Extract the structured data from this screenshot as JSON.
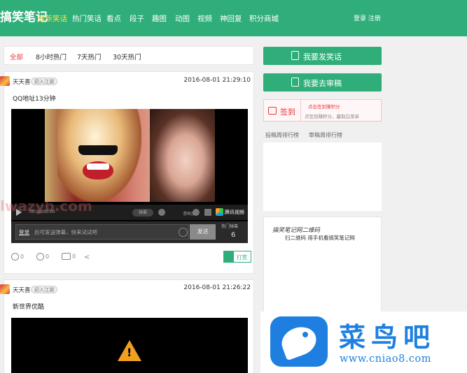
{
  "header": {
    "logo": "搞笑笔记",
    "nav": [
      "最新笑话",
      "热门笑话",
      "看点",
      "段子",
      "趣图",
      "动图",
      "视频",
      "神回复",
      "积分商城"
    ],
    "active_nav": "最新笑话",
    "login": "登录  注册"
  },
  "tabs": [
    "全部",
    "8小时热门",
    "7天热门",
    "30天热门"
  ],
  "posts": [
    {
      "author": "天天喜",
      "badge": "初入江湖",
      "time": "2016-08-01 21:29:10",
      "title": "QQ地址13分钟",
      "player": {
        "time": "00:00/00:00",
        "pill": "弹幕",
        "small": "清晰度",
        "brand": "腾讯视频"
      },
      "comment": {
        "login": "登录",
        "hint": "后可发送弹幕，快来试试吧",
        "send": "发送",
        "hot_label": "热门弹幕",
        "hot_count": "6"
      },
      "actions": {
        "like": "0",
        "dislike": "0",
        "comments": "0",
        "reward": "打赏"
      }
    },
    {
      "author": "天天喜",
      "badge": "初入江湖",
      "time": "2016-08-01 21:26:22",
      "title": "新世界优酷"
    }
  ],
  "sidebar": {
    "publish": "我要发笑话",
    "review": "我要去审稿",
    "checkin": {
      "label": "签到",
      "line1": "点击签到赚积分",
      "line2": "点签到赚积分，赢取白菜单"
    },
    "rank_tabs": [
      "投稿周排行榜",
      "审稿周排行榜"
    ],
    "qr_title": "搞笑笔记网二维码",
    "qr_sub": "扫二维码 用手机看搞笑笔记网"
  },
  "watermark": {
    "cn": "菜鸟吧",
    "url": "www.cniao8.com",
    "ghost": "lwazyb.com"
  },
  "colors": {
    "brand_green": "#2fae7a",
    "active_nav": "#ffe34c",
    "accent_red": "#e4393c",
    "watermark_blue": "#1e7fe0"
  }
}
